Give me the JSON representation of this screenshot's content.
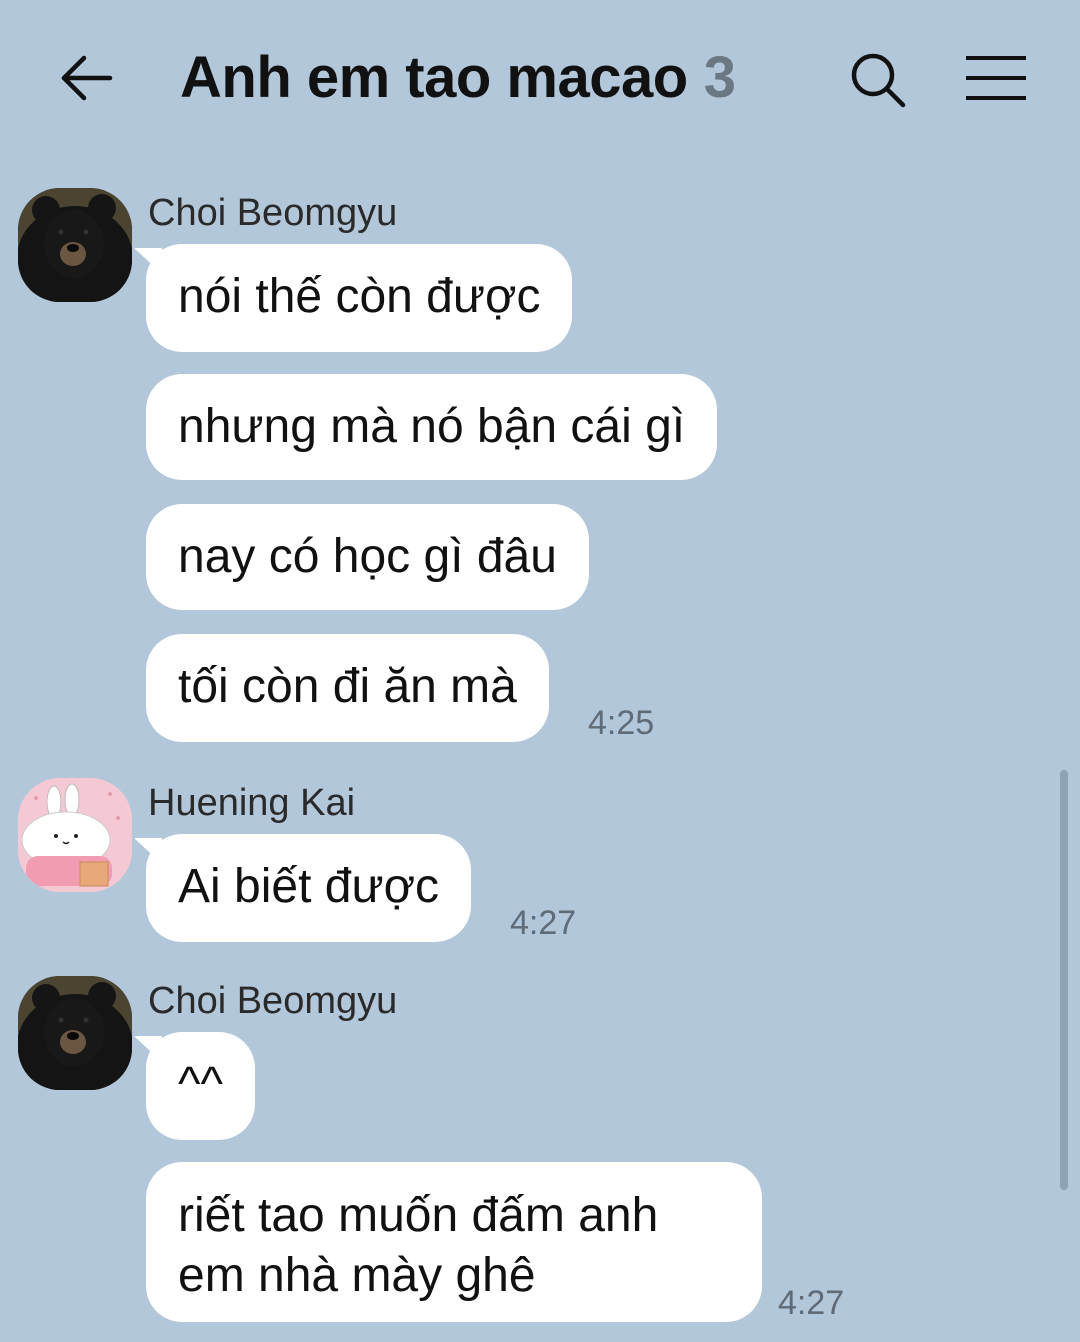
{
  "header": {
    "back_label": "←",
    "title": "Anh em tao macao",
    "member_count": "3"
  },
  "icons": {
    "back": "arrow-left-icon",
    "search": "search-icon",
    "menu": "hamburger-menu-icon"
  },
  "messages": {
    "group1": {
      "sender": "Choi Beomgyu",
      "avatar": "black-bear",
      "bubbles": [
        "nói thế còn được",
        "nhưng mà nó bận cái gì",
        "nay có học gì đâu",
        "tối còn đi ăn mà"
      ],
      "time": "4:25"
    },
    "group2": {
      "sender": "Huening Kai",
      "avatar": "pink-bunny",
      "bubbles": [
        "Ai biết được"
      ],
      "time": "4:27"
    },
    "group3": {
      "sender": "Choi Beomgyu",
      "avatar": "black-bear",
      "bubbles": [
        "^^",
        "riết tao muốn đấm anh em nhà mày ghê"
      ],
      "time": "4:27"
    }
  },
  "colors": {
    "background": "#b2c7da",
    "bubble": "#ffffff",
    "title": "#111111",
    "count": "#6b7783"
  }
}
